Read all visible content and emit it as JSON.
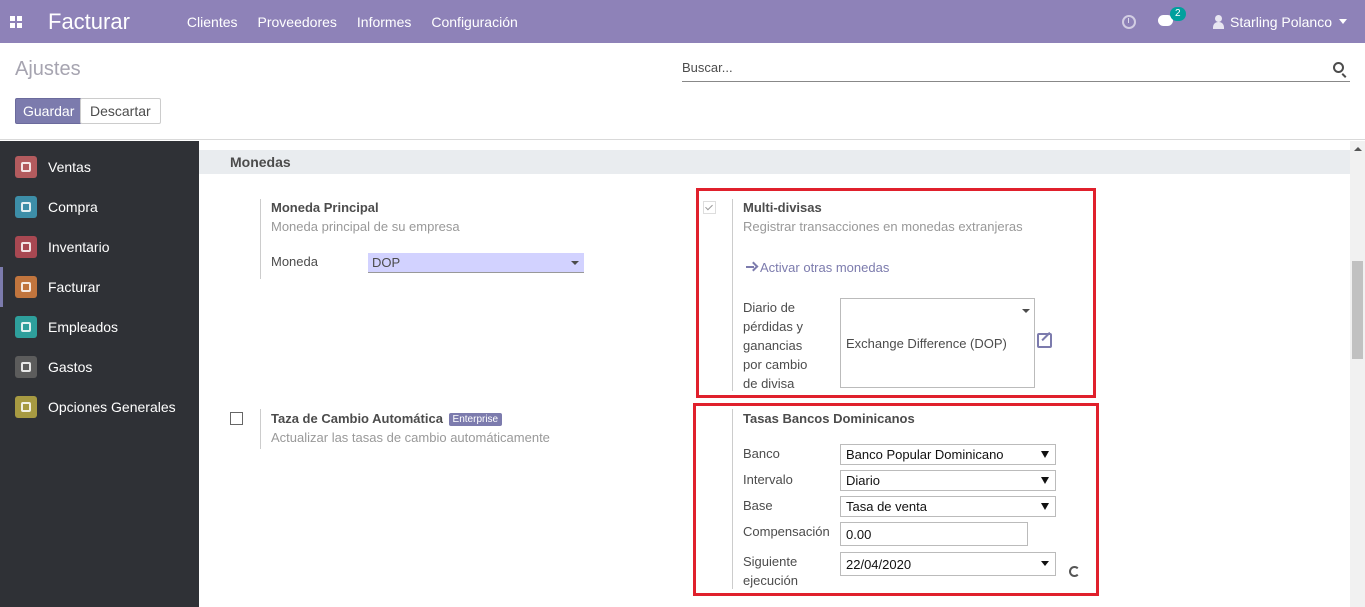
{
  "navbar": {
    "brand": "Facturar",
    "menu": [
      "Clientes",
      "Proveedores",
      "Informes",
      "Configuración"
    ],
    "chat_badge": "2",
    "user_name": "Starling Polanco",
    "background_color": "#8e82b8"
  },
  "control_panel": {
    "title": "Ajustes",
    "save_label": "Guardar",
    "discard_label": "Descartar",
    "search_placeholder": "Buscar..."
  },
  "sidebar": {
    "items": [
      {
        "label": "Ventas",
        "icon": "sales-icon",
        "color": "#b35b5e"
      },
      {
        "label": "Compra",
        "icon": "purchase-icon",
        "color": "#3d8ea8"
      },
      {
        "label": "Inventario",
        "icon": "inventory-icon",
        "color": "#a84852"
      },
      {
        "label": "Facturar",
        "icon": "invoice-icon",
        "color": "#c1753e",
        "active": true
      },
      {
        "label": "Empleados",
        "icon": "employees-icon",
        "color": "#2e9f9c"
      },
      {
        "label": "Gastos",
        "icon": "expenses-icon",
        "color": "#5c5c5c"
      },
      {
        "label": "Opciones Generales",
        "icon": "settings-icon",
        "color": "#a79a42"
      }
    ]
  },
  "section": {
    "title": "Monedas"
  },
  "main_currency": {
    "title": "Moneda Principal",
    "description": "Moneda principal de su empresa",
    "field_label": "Moneda",
    "value": "DOP"
  },
  "multi_currency": {
    "title": "Multi-divisas",
    "description": "Registrar transacciones en monedas extranjeras",
    "checked": true,
    "link_label": "Activar otras monedas",
    "journal_label_lines": [
      "Diario de",
      "pérdidas y",
      "ganancias",
      "por cambio",
      "de divisa"
    ],
    "journal_value": "Exchange Difference (DOP)"
  },
  "auto_rate": {
    "title": "Taza de Cambio Automática",
    "badge": "Enterprise",
    "description": "Actualizar las tasas de cambio automáticamente",
    "checked": false
  },
  "dominican_banks": {
    "title": "Tasas Bancos Dominicanos",
    "bank_label": "Banco",
    "bank_value": "Banco Popular Dominicano",
    "interval_label": "Intervalo",
    "interval_value": "Diario",
    "base_label": "Base",
    "base_value": "Tasa de venta",
    "compensation_label": "Compensación",
    "compensation_value": "0.00",
    "next_run_label_lines": [
      "Siguiente",
      "ejecución"
    ],
    "next_run_value": "22/04/2020"
  },
  "highlight_color": "#e0202c"
}
